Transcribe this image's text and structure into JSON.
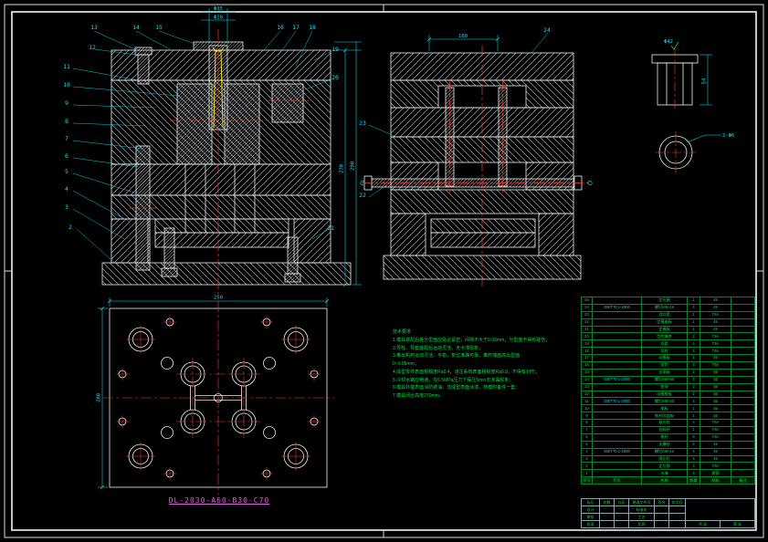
{
  "colors": {
    "background": "#000000",
    "line": "#f0f0f0",
    "dimension": "#00e5ff",
    "centerline": "#ff3b30",
    "notes": "#00dd44",
    "sprue": "#ffe400",
    "plan_title": "#e05fe0"
  },
  "callouts": {
    "left": [
      "12",
      "11",
      "10",
      "9",
      "8",
      "7",
      "6",
      "5",
      "4",
      "3",
      "2"
    ],
    "top": [
      "13",
      "14",
      "15",
      "16",
      "17",
      "18"
    ],
    "right": [
      "19",
      "20",
      "21"
    ],
    "right_view": [
      "23",
      "22",
      "24"
    ]
  },
  "dims": {
    "lv_top_upper": "Φ35",
    "lv_top_lower": "Φ20",
    "lv_right_inner": "270",
    "lv_right_outer": "290",
    "rv_top": "160",
    "plan_top": "250",
    "plan_left": "200",
    "sv_height": "54",
    "sv_dia": "Φ42",
    "sv_note": "2-Φ6"
  },
  "notes": {
    "title": "技术要求",
    "lines": [
      "技术要求",
      "1.模具装配后各分型面应贴合紧密，间隙不大于0.02mm，分型面不得有碰伤；",
      "2.导柱、导套装配后运动灵活，无卡滞现象；",
      "3.推出机构运动灵活、平稳，复位准确可靠，推杆端面高出型面",
      "0~0.05mm；",
      "4.成型零件表面粗糙度Ra0.4，浇注系统表面粗糙度Ra0.8，不得有划伤；",
      "5.冷却水路应畅通，在0.5MPa压力下保压5min无渗漏现象；",
      "6.模具外露表面涂防锈油，非成型表面涂漆，随模附备件一套；",
      "7.模具闭合高度270mm。"
    ]
  },
  "plan": {
    "title": "DL-2030-A60-B30-C70"
  },
  "bom": {
    "headers": [
      "序号",
      "代号",
      "名称",
      "数量",
      "材料",
      "备注"
    ],
    "rows": [
      {
        "no": "25",
        "code": "",
        "name": "定位圈",
        "qty": "1",
        "mat": "45",
        "note": ""
      },
      {
        "no": "24",
        "code": "GB/T70.1-2000",
        "name": "螺钉M6×16",
        "qty": "4",
        "mat": "45",
        "note": ""
      },
      {
        "no": "23",
        "code": "",
        "name": "浇口套",
        "qty": "1",
        "mat": "T8A",
        "note": ""
      },
      {
        "no": "22",
        "code": "",
        "name": "定模座板",
        "qty": "1",
        "mat": "45",
        "note": ""
      },
      {
        "no": "21",
        "code": "",
        "name": "定模板",
        "qty": "1",
        "mat": "45",
        "note": ""
      },
      {
        "no": "20",
        "code": "",
        "name": "型腔镶件",
        "qty": "2",
        "mat": "T8A",
        "note": ""
      },
      {
        "no": "19",
        "code": "",
        "name": "导套",
        "qty": "4",
        "mat": "T8A",
        "note": ""
      },
      {
        "no": "18",
        "code": "",
        "name": "导柱",
        "qty": "4",
        "mat": "T8A",
        "note": ""
      },
      {
        "no": "17",
        "code": "",
        "name": "动模板",
        "qty": "1",
        "mat": "45",
        "note": ""
      },
      {
        "no": "16",
        "code": "",
        "name": "型芯",
        "qty": "4",
        "mat": "T8A",
        "note": ""
      },
      {
        "no": "15",
        "code": "",
        "name": "支承板",
        "qty": "1",
        "mat": "45",
        "note": ""
      },
      {
        "no": "14",
        "code": "GB/T70.1-2000",
        "name": "螺钉M8×80",
        "qty": "4",
        "mat": "45",
        "note": ""
      },
      {
        "no": "13",
        "code": "",
        "name": "垫块",
        "qty": "2",
        "mat": "45",
        "note": ""
      },
      {
        "no": "12",
        "code": "",
        "name": "动模座板",
        "qty": "1",
        "mat": "45",
        "note": ""
      },
      {
        "no": "11",
        "code": "GB/T70.1-2000",
        "name": "螺钉M8×20",
        "qty": "4",
        "mat": "45",
        "note": ""
      },
      {
        "no": "10",
        "code": "",
        "name": "推板",
        "qty": "1",
        "mat": "45",
        "note": ""
      },
      {
        "no": "9",
        "code": "",
        "name": "推杆固定板",
        "qty": "1",
        "mat": "45",
        "note": ""
      },
      {
        "no": "8",
        "code": "",
        "name": "复位杆",
        "qty": "4",
        "mat": "T8A",
        "note": ""
      },
      {
        "no": "7",
        "code": "",
        "name": "拉料杆",
        "qty": "1",
        "mat": "T8A",
        "note": ""
      },
      {
        "no": "6",
        "code": "",
        "name": "推杆",
        "qty": "8",
        "mat": "T8A",
        "note": ""
      },
      {
        "no": "5",
        "code": "",
        "name": "支撑柱",
        "qty": "2",
        "mat": "45",
        "note": ""
      },
      {
        "no": "4",
        "code": "GB/T70.1-2000",
        "name": "螺钉M6×12",
        "qty": "4",
        "mat": "45",
        "note": ""
      },
      {
        "no": "3",
        "code": "",
        "name": "限位钉",
        "qty": "4",
        "mat": "45",
        "note": ""
      },
      {
        "no": "2",
        "code": "",
        "name": "定位销",
        "qty": "4",
        "mat": "T8A",
        "note": ""
      },
      {
        "no": "1",
        "code": "",
        "name": "水嘴",
        "qty": "4",
        "mat": "黄铜",
        "note": ""
      }
    ]
  },
  "titleblock": {
    "c1": "标记",
    "c2": "处数",
    "c3": "分区",
    "c4": "更改文件号",
    "c5": "签名",
    "c6": "年月日",
    "r2a": "设计",
    "r2b": "标准化",
    "r3a": "审核",
    "r3b": "工艺",
    "r4a": "批准",
    "scale_label": "比例",
    "sheets": "共 张",
    "sheet_no": "第 张"
  }
}
